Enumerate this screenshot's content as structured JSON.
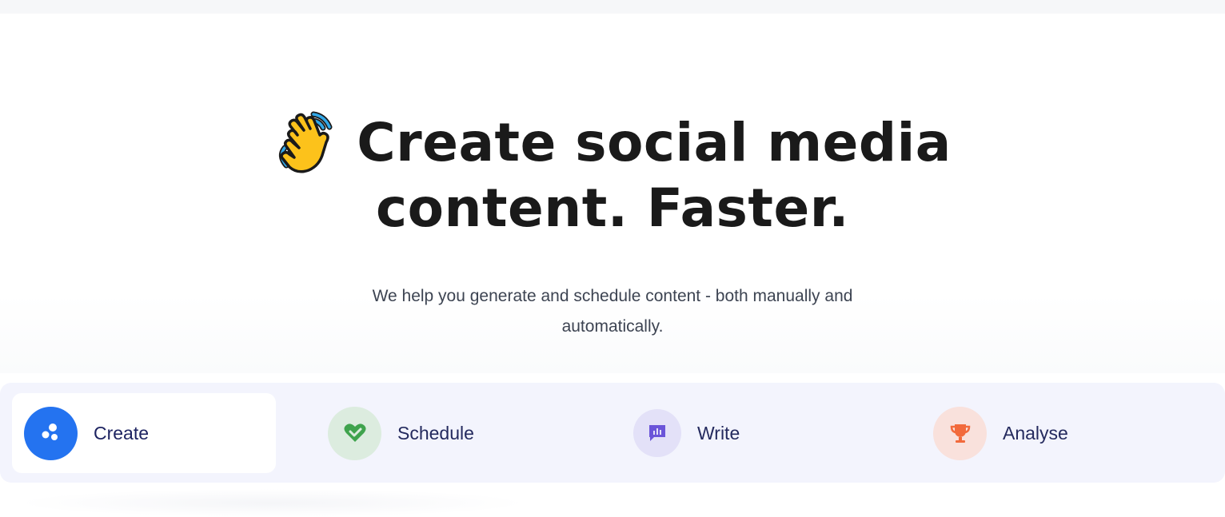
{
  "hero": {
    "headline_line1": "Create social media",
    "headline_line2": "content. Faster.",
    "wave_icon": "waving-hand-icon",
    "subtitle": "We help you generate and schedule content - both manually and automatically."
  },
  "tabs": [
    {
      "label": "Create",
      "icon": "bubbles-icon",
      "active": true,
      "icon_bg": "#2473f0",
      "icon_color": "#ffffff"
    },
    {
      "label": "Schedule",
      "icon": "heart-handshake-icon",
      "active": false,
      "icon_bg": "#dcecdf",
      "icon_color": "#3fa34d"
    },
    {
      "label": "Write",
      "icon": "chat-chart-icon",
      "active": false,
      "icon_bg": "#e3e1f8",
      "icon_color": "#6b55d9"
    },
    {
      "label": "Analyse",
      "icon": "trophy-icon",
      "active": false,
      "icon_bg": "#f9e1dc",
      "icon_color": "#f26a3c"
    }
  ],
  "colors": {
    "accent": "#2473f0",
    "heading": "#1a1a1a",
    "tab_text": "#242a5e",
    "tabbar_bg": "#f3f4fd"
  }
}
